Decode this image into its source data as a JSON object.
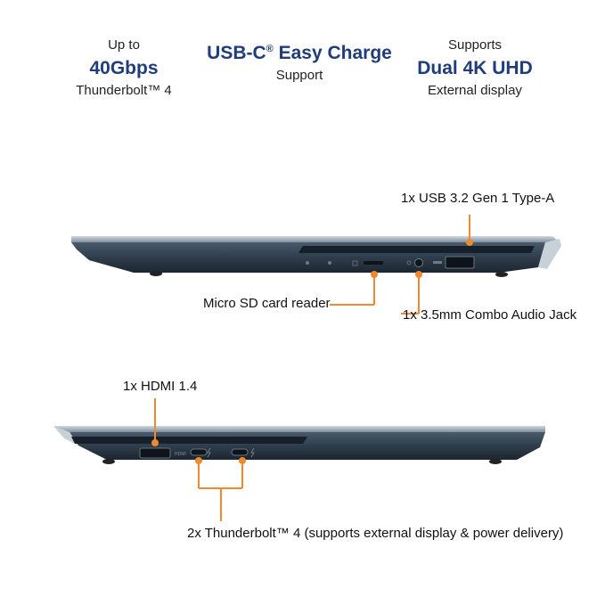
{
  "features": [
    {
      "top": "Up to",
      "big": "40Gbps",
      "bottom": "Thunderbolt™ 4"
    },
    {
      "top": "",
      "big_main": "USB-C",
      "big_mark": "®",
      "big_rest": " Easy Charge",
      "bottom": "Support"
    },
    {
      "top": "Supports",
      "big": "Dual 4K UHD",
      "bottom": "External display"
    }
  ],
  "right_side": {
    "usb_a": "1x USB 3.2 Gen 1 Type-A",
    "sd": "Micro SD card reader",
    "audio": "1x 3.5mm Combo Audio Jack"
  },
  "left_side": {
    "hdmi": "1x HDMI 1.4",
    "tb": "2x Thunderbolt™ 4 (supports external display & power delivery)"
  },
  "colors": {
    "accent": "#1f3d7a",
    "callout": "#f0892f",
    "body": "#2f3f4e"
  }
}
